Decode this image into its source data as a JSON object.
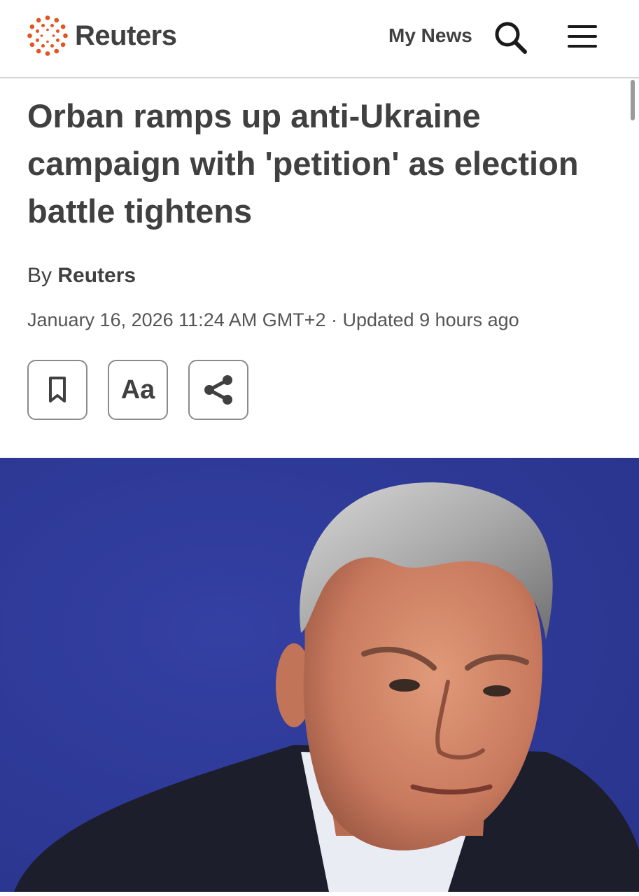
{
  "header": {
    "brand": "Reuters",
    "my_news_label": "My News",
    "logo_color": "#e35420",
    "icons": [
      "reuters-logo",
      "search-icon",
      "menu-icon"
    ]
  },
  "article": {
    "headline": "Orban ramps up anti-Ukraine campaign with 'petition' as election battle tightens",
    "byline_prefix": "By",
    "author": "Reuters",
    "dateline": "January 16, 2026 11:24 AM GMT+2 · Updated 9 hours ago"
  },
  "tools": {
    "bookmark_icon": "bookmark-icon",
    "font_size_label": "Aa",
    "share_icon": "share-icon"
  },
  "hero_image": {
    "background_color": "#2b3690"
  }
}
